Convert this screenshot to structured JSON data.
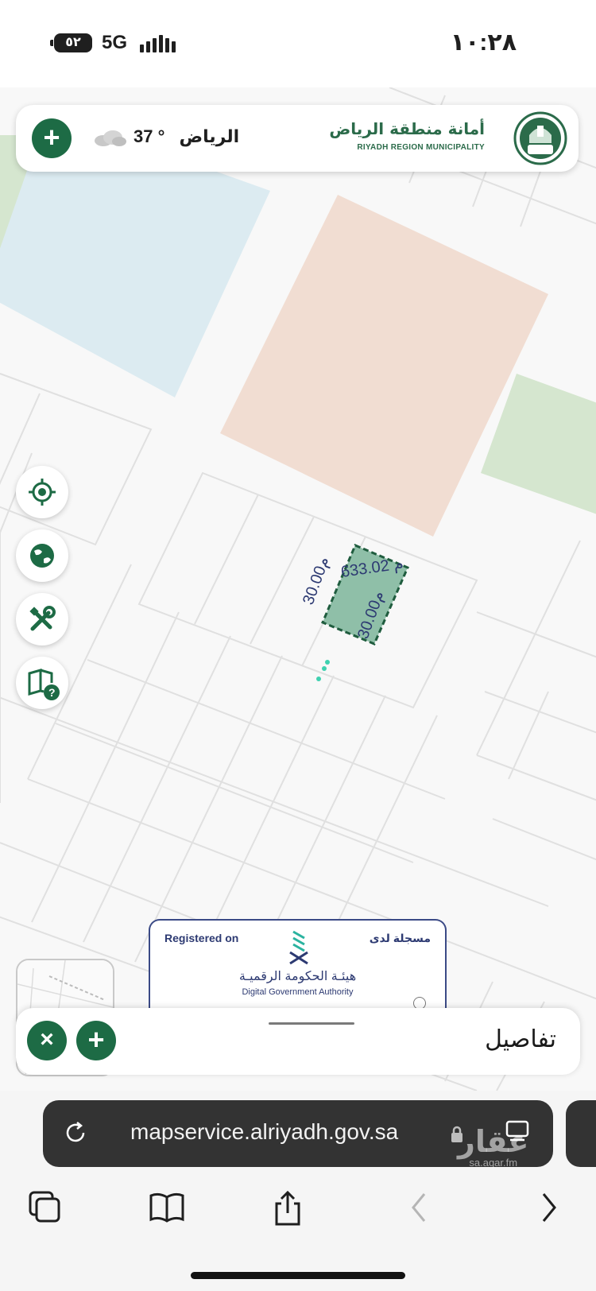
{
  "status_bar": {
    "time": "١٠:٢٨",
    "network": "5G",
    "battery": "٥٢"
  },
  "header": {
    "city": "الرياض",
    "temperature": "37 °",
    "logo_ar": "أمانة منطقة الرياض",
    "logo_en": "RIYADH REGION MUNICIPALITY",
    "emblem_text": "الرياض",
    "weather_icon": "cloud-icon",
    "add_icon": "plus-icon"
  },
  "map": {
    "selected_parcel": {
      "area_label": "633.02 م",
      "side_a_label": "30.00م",
      "side_b_label": "30.00م"
    },
    "colors": {
      "parcel_fill": "#8fbfa8",
      "parcel_border": "#1f5c3e",
      "commercial": "#f1ddd2",
      "park": "#d5e6cf",
      "water": "#dcebf1"
    }
  },
  "tools": [
    {
      "icon": "locate-icon"
    },
    {
      "icon": "globe-icon"
    },
    {
      "icon": "tools-icon"
    },
    {
      "icon": "help-book-icon"
    }
  ],
  "dga_badge": {
    "registered_en": "Registered on",
    "registered_ar": "مسجلة لدى",
    "authority_ar": "هيئـة الحكومة الرقميـة",
    "authority_en": "Digital Government Authority"
  },
  "details_panel": {
    "title": "تفاصيل",
    "close_icon": "close-icon",
    "expand_icon": "plus-icon"
  },
  "browser": {
    "url": "mapservice.alriyadh.gov.sa",
    "watermark_ar": "عقار",
    "watermark_en": "sa.aqar.fm"
  }
}
